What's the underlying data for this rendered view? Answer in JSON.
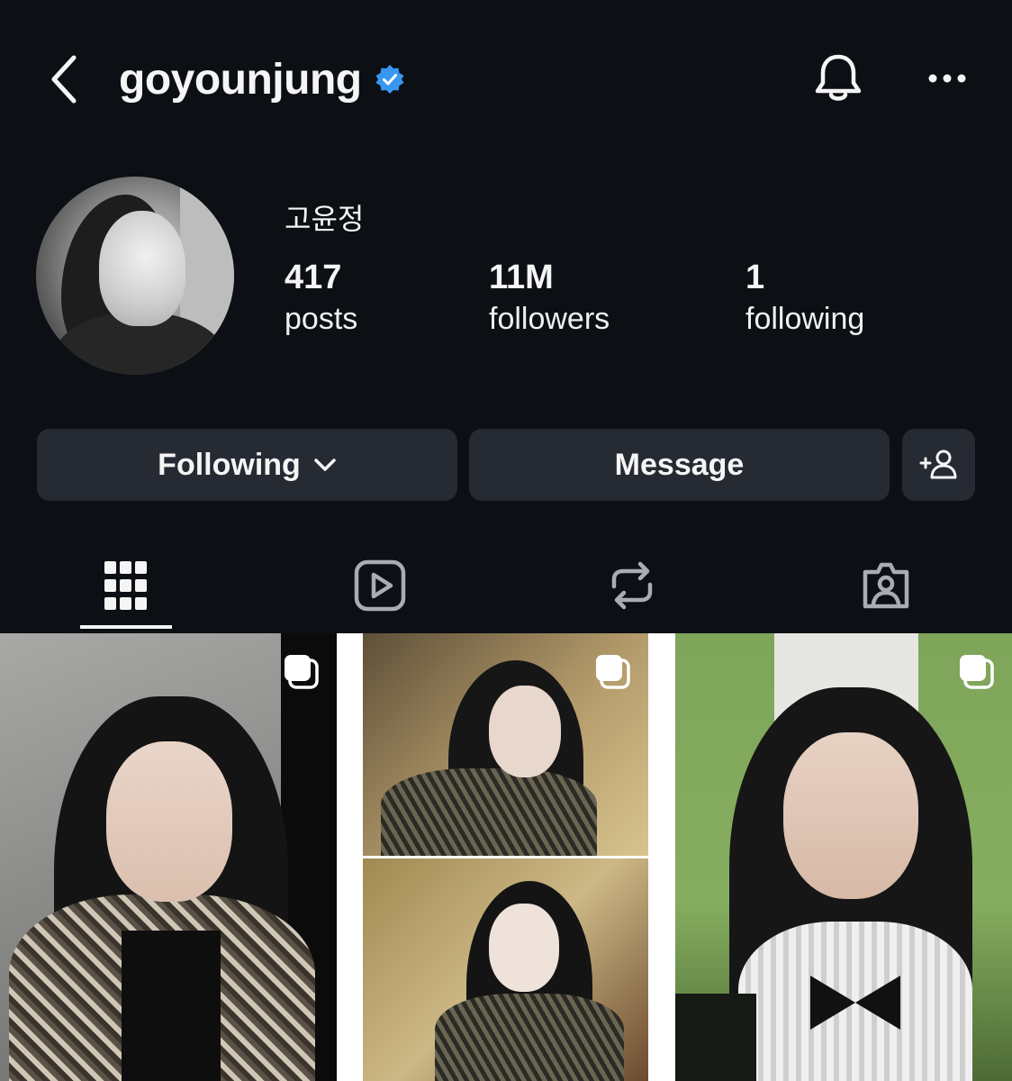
{
  "header": {
    "username": "goyounjung",
    "verified": true,
    "verified_color": "#3897f0"
  },
  "profile": {
    "display_name": "고윤정",
    "stats": [
      {
        "value": "417",
        "label": "posts"
      },
      {
        "value": "11M",
        "label": "followers"
      },
      {
        "value": "1",
        "label": "following"
      }
    ]
  },
  "actions": {
    "following_label": "Following",
    "message_label": "Message"
  },
  "tabs": [
    {
      "icon": "grid-icon",
      "active": true
    },
    {
      "icon": "reels-icon",
      "active": false
    },
    {
      "icon": "reposts-icon",
      "active": false
    },
    {
      "icon": "tagged-icon",
      "active": false
    }
  ],
  "colors": {
    "background": "#0c0f14",
    "button": "#262a33",
    "text": "#f5f5f5"
  },
  "posts": [
    {
      "type": "carousel",
      "icon": "multiple-posts-icon"
    },
    {
      "type": "carousel",
      "icon": "multiple-posts-icon"
    },
    {
      "type": "carousel",
      "icon": "multiple-posts-icon"
    }
  ]
}
